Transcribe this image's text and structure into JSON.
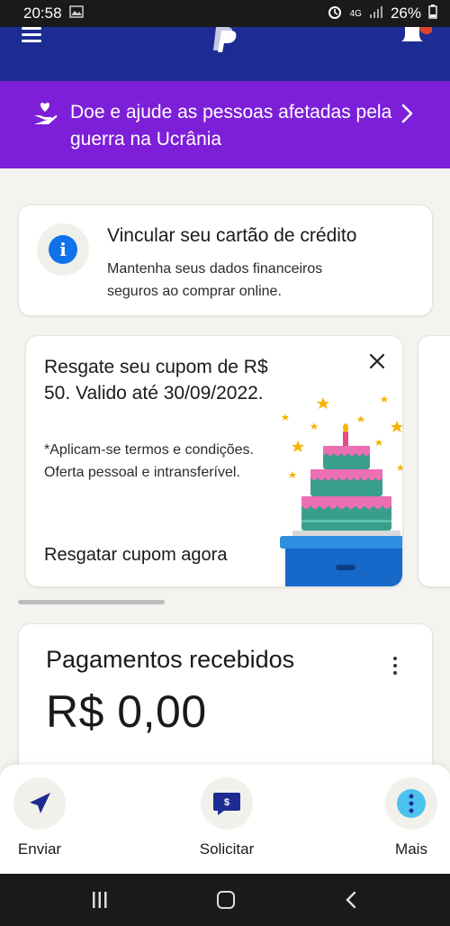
{
  "status_bar": {
    "time": "20:58",
    "network": "4G",
    "battery": "26%"
  },
  "header": {
    "menu_icon": "hamburger-icon",
    "logo_icon": "paypal-logo",
    "bell_icon": "bell-icon"
  },
  "banner": {
    "text": "Doe e ajude as pessoas afetadas pela guerra na Ucrânia",
    "icon": "donate-hand-icon",
    "accent": "#7d1fd8"
  },
  "link_card": {
    "title": "Vincular seu cartão de crédito",
    "subtitle": "Mantenha seus dados financeiros seguros ao comprar online.",
    "icon": "info-icon"
  },
  "coupon": {
    "title": "Resgate seu cupom de R$ 50. Valido até 30/09/2022.",
    "terms": "*Aplicam-se termos e condições. Oferta pessoal e intransferível.",
    "cta": "Resgatar cupom agora",
    "image": "birthday-cake-illustration"
  },
  "payments": {
    "title": "Pagamentos recebidos",
    "amount": "R$ 0,00"
  },
  "actions": [
    {
      "label": "Enviar",
      "icon": "send-icon"
    },
    {
      "label": "Solicitar",
      "icon": "request-icon"
    },
    {
      "label": "Mais",
      "icon": "more-icon"
    }
  ],
  "colors": {
    "brand_navy": "#1c2c92",
    "info_blue": "#1072eb"
  }
}
